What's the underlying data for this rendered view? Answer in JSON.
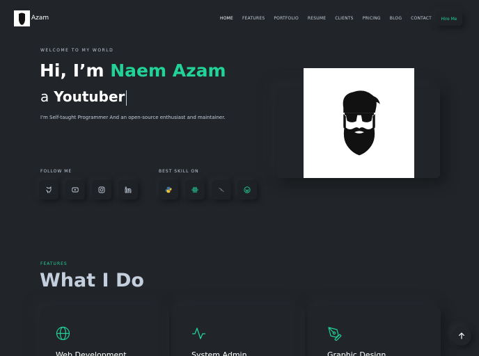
{
  "header": {
    "brand": "Azam",
    "nav": [
      "HOME",
      "FEATURES",
      "PORTFOLIO",
      "RESUME",
      "CLIENTS",
      "PRICING",
      "BLOG",
      "CONTACT"
    ],
    "cta": "Hire Me"
  },
  "hero": {
    "welcome": "WELCOME TO MY WORLD",
    "greeting": "Hi, I’m ",
    "name": "Naem Azam",
    "role_prefix": "a",
    "role": "Youtuber",
    "description": "I'm Self-taught Programmer And an open-source enthusiast and maintainer.",
    "follow_title": "FOLLOW ME",
    "skill_title": "BEST SKILL ON",
    "social_icons": [
      "github-icon",
      "youtube-icon",
      "instagram-icon",
      "linkedin-icon"
    ],
    "skill_icons": [
      "python-icon",
      "react-icon",
      "laravel-icon",
      "wordpress-icon"
    ]
  },
  "features": {
    "label": "FEATURES",
    "title": "What I Do",
    "cards": [
      {
        "title": "Web Development",
        "icon": "globe-icon"
      },
      {
        "title": "System Admin",
        "icon": "activity-icon"
      },
      {
        "title": "Graphic Design",
        "icon": "pen-tool-icon"
      }
    ]
  },
  "colors": {
    "accent": "#21d397",
    "background": "#212428",
    "text": "#c4cfde"
  }
}
